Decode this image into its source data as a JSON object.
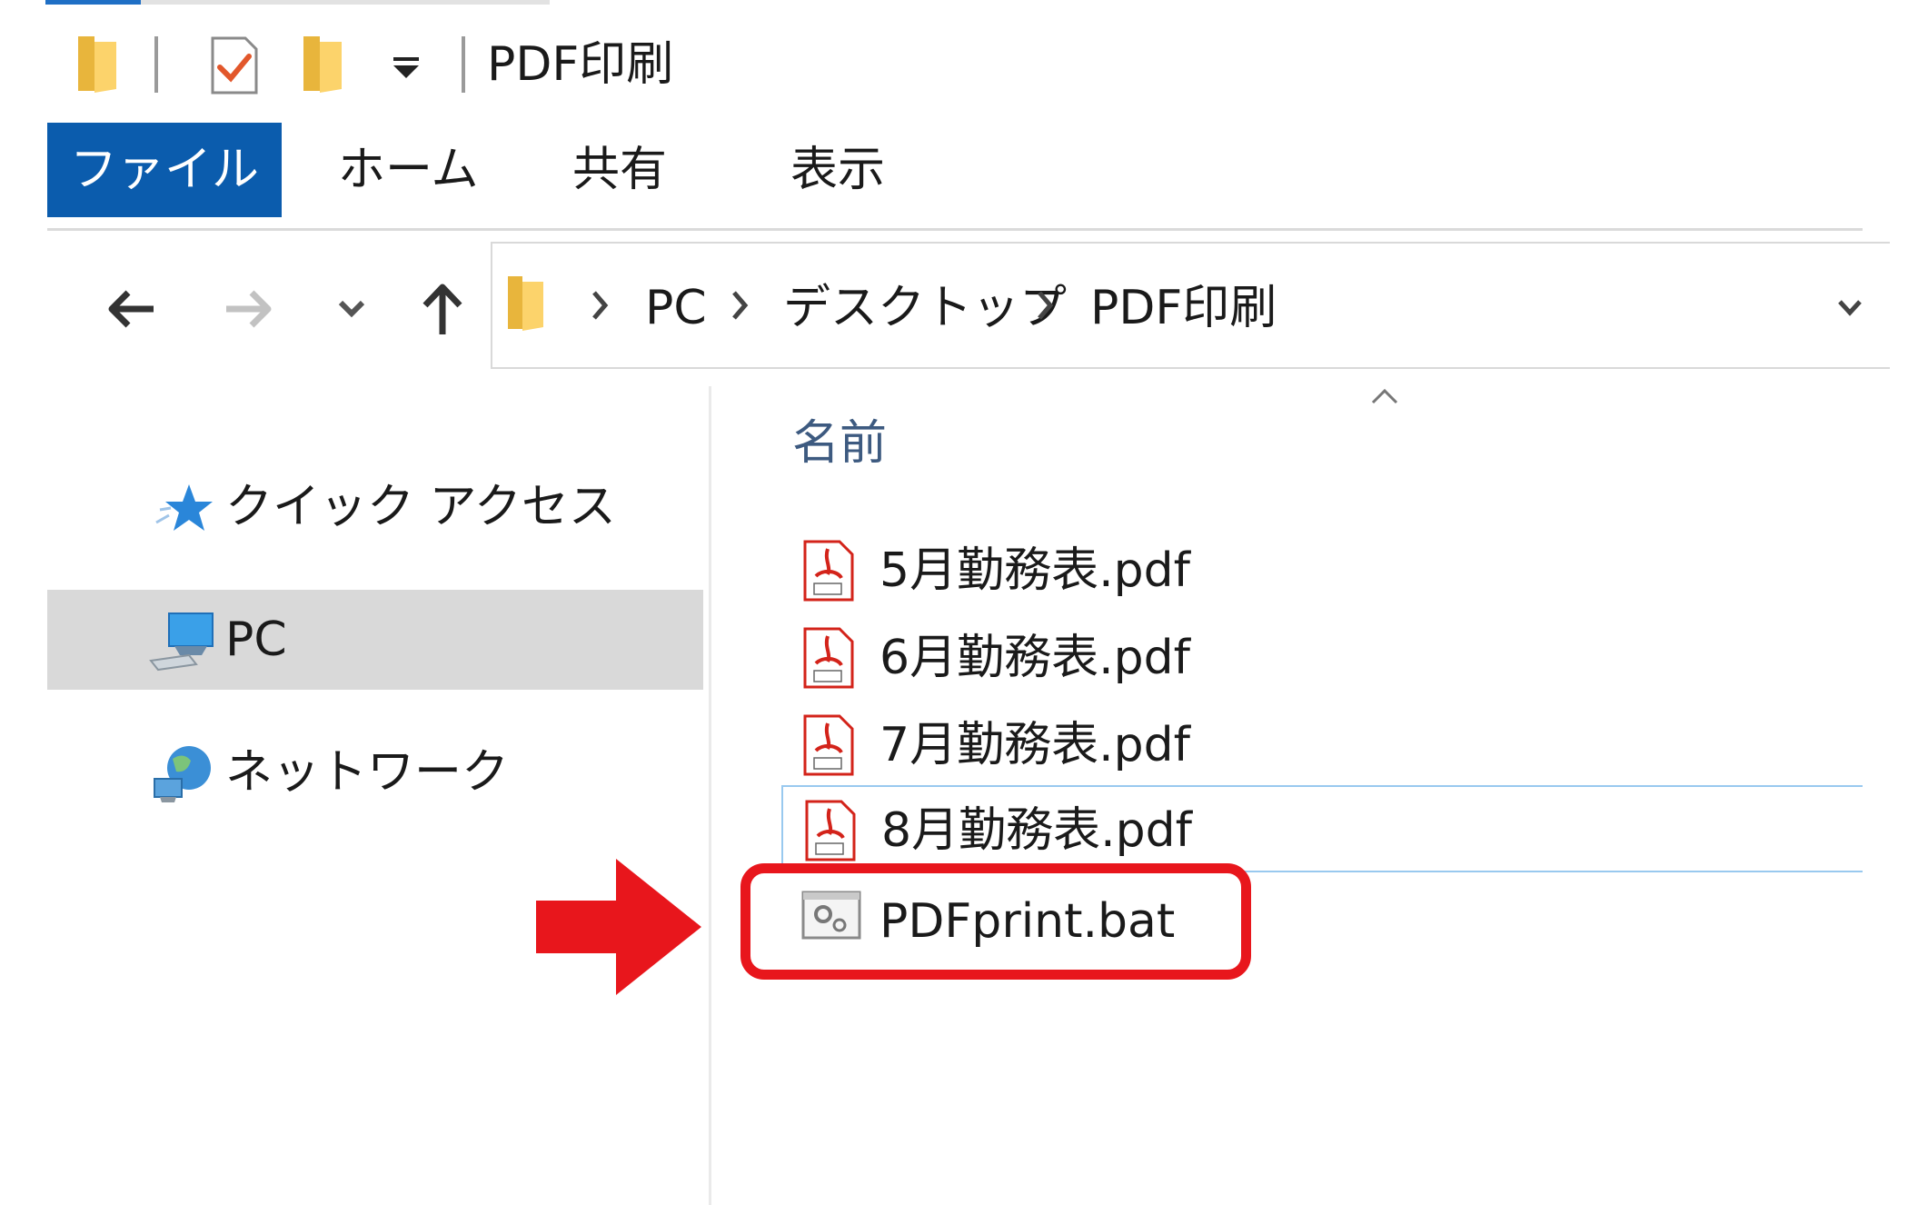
{
  "window": {
    "title": "PDF印刷"
  },
  "ribbon": {
    "tabs": [
      {
        "label": "ファイル",
        "active": true
      },
      {
        "label": "ホーム"
      },
      {
        "label": "共有"
      },
      {
        "label": "表示"
      }
    ]
  },
  "address_bar": {
    "breadcrumbs": [
      "PC",
      "デスクトップ",
      "PDF印刷"
    ]
  },
  "nav_pane": {
    "items": [
      {
        "label": "クイック アクセス",
        "icon": "star-icon"
      },
      {
        "label": "PC",
        "icon": "computer-icon",
        "selected": true
      },
      {
        "label": "ネットワーク",
        "icon": "network-icon"
      }
    ]
  },
  "file_list": {
    "column_header": "名前",
    "files": [
      {
        "name": "5月勤務表.pdf",
        "icon": "pdf-icon"
      },
      {
        "name": "6月勤務表.pdf",
        "icon": "pdf-icon"
      },
      {
        "name": "7月勤務表.pdf",
        "icon": "pdf-icon"
      },
      {
        "name": "8月勤務表.pdf",
        "icon": "pdf-icon",
        "hovered": true
      },
      {
        "name": "PDFprint.bat",
        "icon": "batch-file-icon",
        "highlighted": true
      }
    ]
  },
  "colors": {
    "file_tab": "#0b5cad",
    "selected_nav": "#d9d9d9",
    "highlight": "#e8161c",
    "hover_border": "#99c9ef"
  }
}
